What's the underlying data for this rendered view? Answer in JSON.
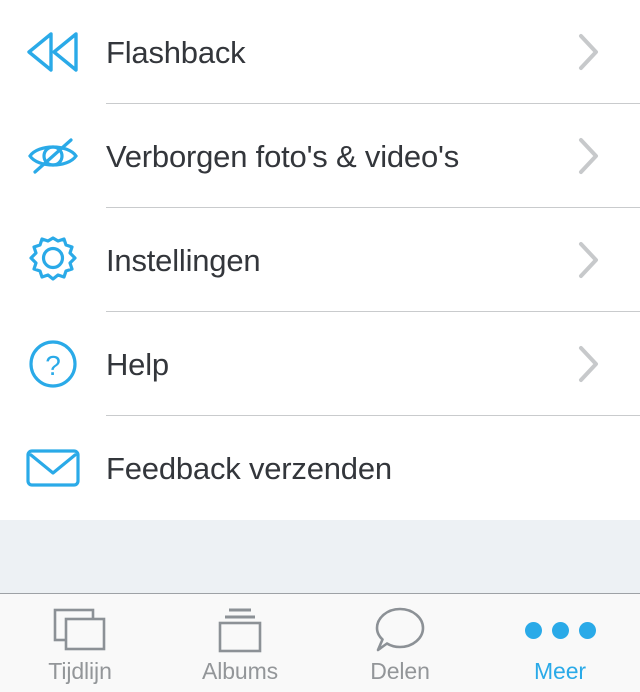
{
  "theme": {
    "accent_blue": "#2aaae8",
    "label_dark": "#33363b",
    "chevron_gray": "#c7c9cb",
    "separator_gray": "#c9cbcd",
    "filler_bg": "#edf1f4",
    "tabbar_bg": "#f9f9f9",
    "tab_inactive": "#939699"
  },
  "list": {
    "rows": [
      {
        "label": "Flashback",
        "icon": "rewind-double-chevron-icon",
        "has_chevron": true
      },
      {
        "label": "Verborgen foto's & video's",
        "icon": "eye-slash-icon",
        "has_chevron": true
      },
      {
        "label": "Instellingen",
        "icon": "gear-icon",
        "has_chevron": true
      },
      {
        "label": "Help",
        "icon": "question-mark-circle-icon",
        "has_chevron": true
      },
      {
        "label": "Feedback verzenden",
        "icon": "envelope-icon",
        "has_chevron": false
      }
    ]
  },
  "tabbar": {
    "tabs": [
      {
        "label": "Tijdlijn",
        "icon": "stacked-photos-icon",
        "active": false
      },
      {
        "label": "Albums",
        "icon": "albums-stack-icon",
        "active": false
      },
      {
        "label": "Delen",
        "icon": "speech-bubble-icon",
        "active": false
      },
      {
        "label": "Meer",
        "icon": "three-dots-icon",
        "active": true
      }
    ]
  }
}
